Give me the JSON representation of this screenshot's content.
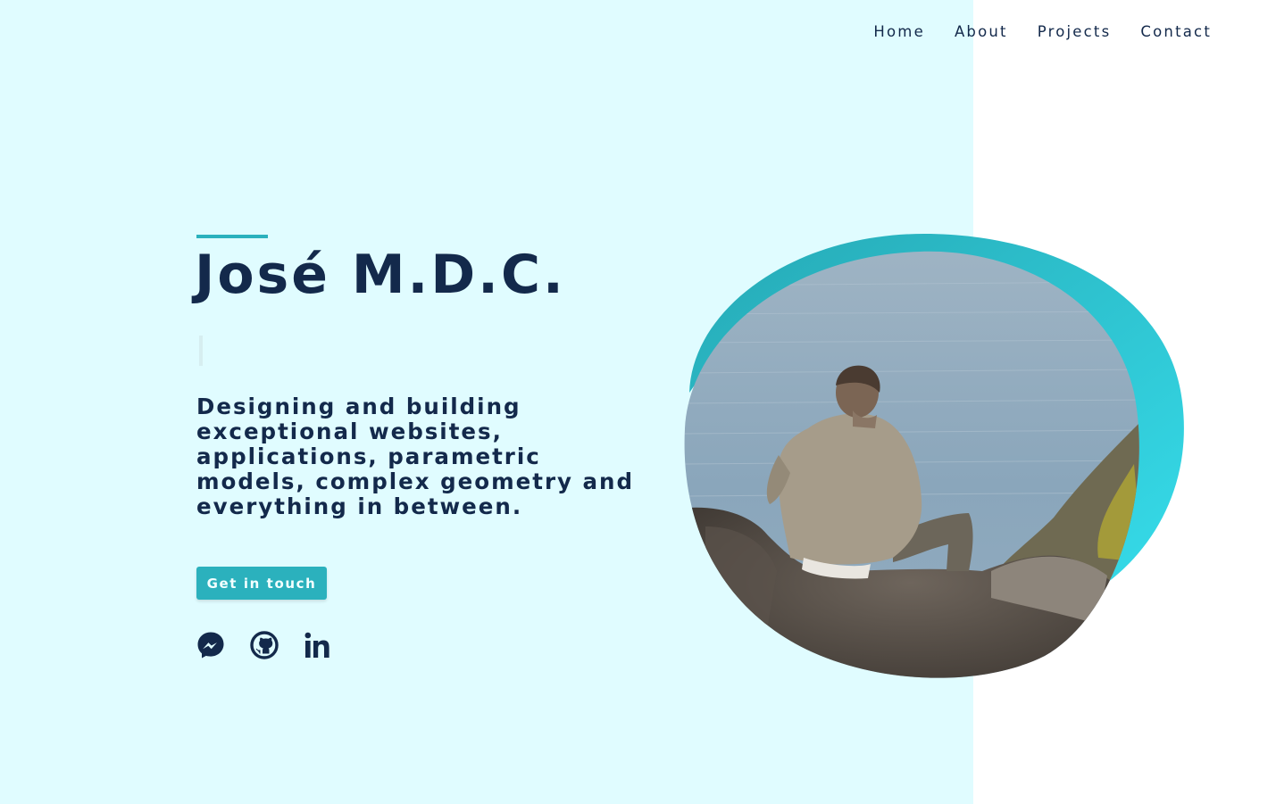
{
  "nav": {
    "items": [
      "Home",
      "About",
      "Projects",
      "Contact"
    ]
  },
  "hero": {
    "name": "José M.D.C.",
    "tagline": "Designing and building exceptional websites, applications, parametric models, complex geometry and everything in between.",
    "cta_label": "Get in touch"
  },
  "socials": [
    {
      "icon": "messenger-icon"
    },
    {
      "icon": "github-icon"
    },
    {
      "icon": "linkedin-icon"
    }
  ],
  "theme": {
    "navy": "#13294b",
    "accent": "#2bb1bd",
    "accent_light": "#34d6e6",
    "panel_bg": "#e0fcff"
  }
}
